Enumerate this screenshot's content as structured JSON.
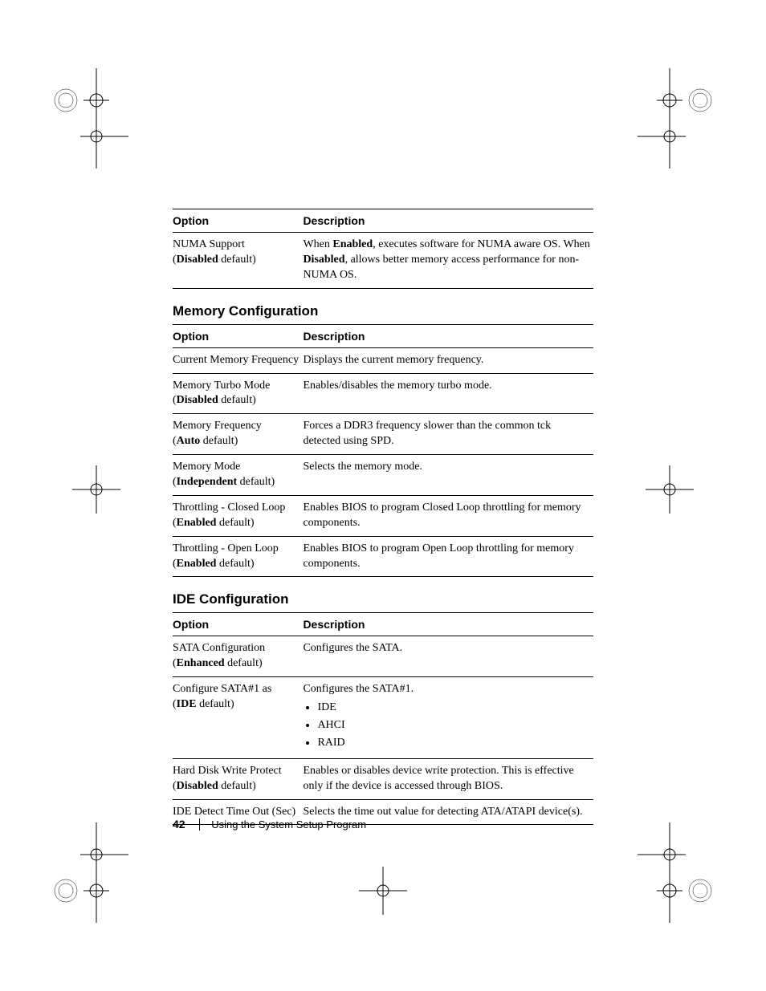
{
  "tables": {
    "top": {
      "headers": {
        "option": "Option",
        "description": "Description"
      },
      "rows": [
        {
          "opt_line1": "NUMA Support",
          "opt_default_open": "(",
          "opt_default_bold": "Disabled",
          "opt_default_close": " default)",
          "desc_p1a": "When ",
          "desc_p1b": "Enabled",
          "desc_p1c": ", executes software for NUMA aware OS. When ",
          "desc_p1d": "Disabled",
          "desc_p1e": ", allows better memory access performance for non-NUMA OS."
        }
      ]
    },
    "memory": {
      "heading": "Memory Configuration",
      "headers": {
        "option": "Option",
        "description": "Description"
      },
      "rows": [
        {
          "opt_line1": "Current Memory Frequency",
          "has_default": false,
          "desc": "Displays the current memory frequency."
        },
        {
          "opt_line1": "Memory Turbo Mode",
          "has_default": true,
          "opt_default_bold": "Disabled",
          "desc": "Enables/disables the memory turbo mode."
        },
        {
          "opt_line1": "Memory Frequency",
          "has_default": true,
          "opt_default_bold": "Auto",
          "desc": "Forces a DDR3 frequency slower than the common tck detected using SPD."
        },
        {
          "opt_line1": "Memory Mode",
          "has_default": true,
          "opt_default_bold": "Independent",
          "desc": "Selects the memory mode."
        },
        {
          "opt_line1": "Throttling - Closed Loop",
          "has_default": true,
          "opt_default_bold": "Enabled",
          "desc": "Enables BIOS to program Closed Loop throttling for memory components."
        },
        {
          "opt_line1": "Throttling - Open Loop",
          "has_default": true,
          "opt_default_bold": "Enabled",
          "desc": "Enables BIOS to program Open Loop throttling for memory components."
        }
      ]
    },
    "ide": {
      "heading": "IDE Configuration",
      "headers": {
        "option": "Option",
        "description": "Description"
      },
      "rows": [
        {
          "opt_line1": "SATA Configuration",
          "has_default": true,
          "opt_default_bold": "Enhanced",
          "desc": "Configures the SATA."
        },
        {
          "opt_line1": "Configure SATA#1 as",
          "has_default": true,
          "opt_default_bold": "IDE",
          "desc": "Configures the SATA#1.",
          "list": [
            "IDE",
            "AHCI",
            "RAID"
          ]
        },
        {
          "opt_line1": "Hard Disk Write Protect",
          "has_default": true,
          "opt_default_bold": "Disabled",
          "desc": "Enables or disables device write protection. This is effective only if the device is accessed through BIOS."
        },
        {
          "opt_line1": "IDE Detect Time Out (Sec)",
          "has_default": false,
          "desc": "Selects the time out value for detecting ATA/ATAPI device(s)."
        }
      ]
    }
  },
  "footer": {
    "page_number": "42",
    "section_title": "Using the System Setup Program"
  },
  "default_paren_open": "(",
  "default_paren_close": " default)"
}
